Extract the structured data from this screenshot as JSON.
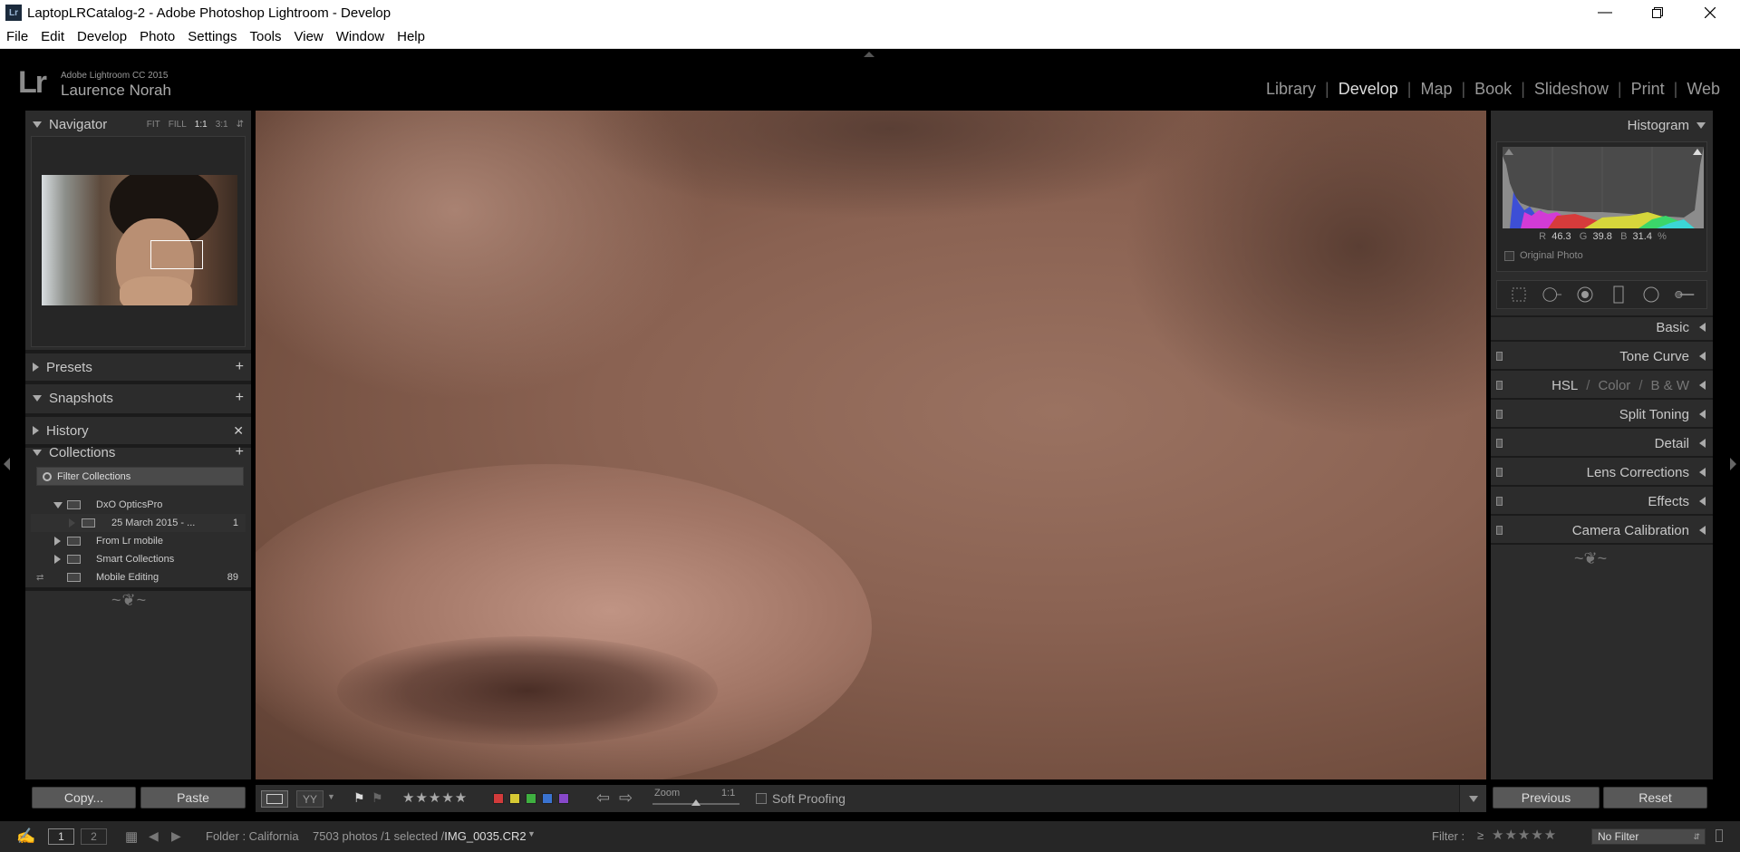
{
  "window": {
    "title": "LaptopLRCatalog-2 - Adobe Photoshop Lightroom - Develop",
    "app_icon": "Lr",
    "controls": [
      "minimize-icon",
      "restore-icon",
      "close-icon"
    ]
  },
  "menu": [
    "File",
    "Edit",
    "Develop",
    "Photo",
    "Settings",
    "Tools",
    "View",
    "Window",
    "Help"
  ],
  "identity": {
    "logo": "Lr",
    "app_name": "Adobe Lightroom CC 2015",
    "user_name": "Laurence Norah"
  },
  "modules": {
    "items": [
      "Library",
      "Develop",
      "Map",
      "Book",
      "Slideshow",
      "Print",
      "Web"
    ],
    "active": "Develop"
  },
  "navigator": {
    "title": "Navigator",
    "zoom_options": [
      "FIT",
      "FILL",
      "1:1",
      "3:1"
    ],
    "active_zoom": "1:1"
  },
  "left_panels": {
    "presets": "Presets",
    "snapshots": "Snapshots",
    "history": "History",
    "collections": "Collections"
  },
  "collections": {
    "filter_placeholder": "Filter Collections",
    "items": [
      {
        "name": "DxO OpticsPro",
        "count": "",
        "expanded": true
      },
      {
        "name": "25 March 2015 - ...",
        "count": "1"
      },
      {
        "name": "From Lr mobile",
        "count": ""
      },
      {
        "name": "Smart Collections",
        "count": ""
      },
      {
        "name": "Mobile Editing",
        "count": "89"
      }
    ]
  },
  "left_buttons": {
    "copy": "Copy...",
    "paste": "Paste"
  },
  "histogram": {
    "title": "Histogram",
    "r_label": "R",
    "r_value": "46.3",
    "g_label": "G",
    "g_value": "39.8",
    "b_label": "B",
    "b_value": "31.4",
    "unit": "%",
    "original_photo": "Original Photo"
  },
  "tools": [
    "crop-overlay-icon",
    "spot-removal-icon",
    "red-eye-icon",
    "graduated-filter-icon",
    "radial-filter-icon",
    "adjustment-brush-icon"
  ],
  "right_sections": {
    "basic": "Basic",
    "tone_curve": "Tone Curve",
    "hsl": "HSL",
    "color": "Color",
    "bw": "B & W",
    "split_toning": "Split Toning",
    "detail": "Detail",
    "lens_corrections": "Lens Corrections",
    "effects": "Effects",
    "camera_calibration": "Camera Calibration"
  },
  "right_buttons": {
    "previous": "Previous",
    "reset": "Reset"
  },
  "toolbar": {
    "zoom_label": "Zoom",
    "zoom_value": "1:1",
    "zoom_level": 0.5,
    "soft_proofing": "Soft Proofing",
    "stars": "★★★★★",
    "color_labels": [
      "#d23b3b",
      "#d6c934",
      "#3fb040",
      "#3a73d0",
      "#8748c9"
    ]
  },
  "filmstrip": {
    "screen1": "1",
    "screen2": "2",
    "folder": "Folder : California",
    "photo_info": "7503 photos /1 selected /",
    "file_name": "IMG_0035.CR2",
    "filter_label": "Filter :",
    "filter_symbol": "≥",
    "filter_stars": "★★★★★",
    "filter_value": "No Filter"
  }
}
